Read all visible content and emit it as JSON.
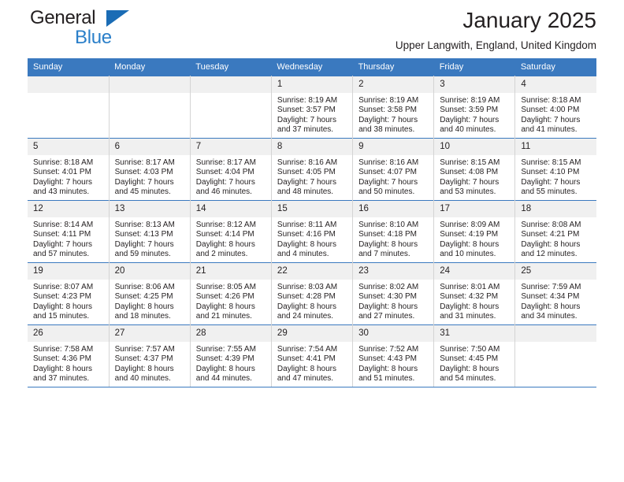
{
  "brand": {
    "word_one": "General",
    "word_two": "Blue",
    "triangle_color": "#1a6cb5",
    "blue_color": "#2a7fc9"
  },
  "header": {
    "title": "January 2025",
    "subtitle": "Upper Langwith, England, United Kingdom",
    "header_bg": "#3a79bf",
    "daynum_bg": "#f0f0f0"
  },
  "weekday_headers": [
    "Sunday",
    "Monday",
    "Tuesday",
    "Wednesday",
    "Thursday",
    "Friday",
    "Saturday"
  ],
  "labels": {
    "sunrise": "Sunrise:",
    "sunset": "Sunset:",
    "daylight": "Daylight:"
  },
  "weeks": [
    [
      {
        "day": "",
        "empty": true
      },
      {
        "day": "",
        "empty": true
      },
      {
        "day": "",
        "empty": true
      },
      {
        "day": "1",
        "sunrise": "Sunrise: 8:19 AM",
        "sunset": "Sunset: 3:57 PM",
        "daylight1": "Daylight: 7 hours",
        "daylight2": "and 37 minutes."
      },
      {
        "day": "2",
        "sunrise": "Sunrise: 8:19 AM",
        "sunset": "Sunset: 3:58 PM",
        "daylight1": "Daylight: 7 hours",
        "daylight2": "and 38 minutes."
      },
      {
        "day": "3",
        "sunrise": "Sunrise: 8:19 AM",
        "sunset": "Sunset: 3:59 PM",
        "daylight1": "Daylight: 7 hours",
        "daylight2": "and 40 minutes."
      },
      {
        "day": "4",
        "sunrise": "Sunrise: 8:18 AM",
        "sunset": "Sunset: 4:00 PM",
        "daylight1": "Daylight: 7 hours",
        "daylight2": "and 41 minutes."
      }
    ],
    [
      {
        "day": "5",
        "sunrise": "Sunrise: 8:18 AM",
        "sunset": "Sunset: 4:01 PM",
        "daylight1": "Daylight: 7 hours",
        "daylight2": "and 43 minutes."
      },
      {
        "day": "6",
        "sunrise": "Sunrise: 8:17 AM",
        "sunset": "Sunset: 4:03 PM",
        "daylight1": "Daylight: 7 hours",
        "daylight2": "and 45 minutes."
      },
      {
        "day": "7",
        "sunrise": "Sunrise: 8:17 AM",
        "sunset": "Sunset: 4:04 PM",
        "daylight1": "Daylight: 7 hours",
        "daylight2": "and 46 minutes."
      },
      {
        "day": "8",
        "sunrise": "Sunrise: 8:16 AM",
        "sunset": "Sunset: 4:05 PM",
        "daylight1": "Daylight: 7 hours",
        "daylight2": "and 48 minutes."
      },
      {
        "day": "9",
        "sunrise": "Sunrise: 8:16 AM",
        "sunset": "Sunset: 4:07 PM",
        "daylight1": "Daylight: 7 hours",
        "daylight2": "and 50 minutes."
      },
      {
        "day": "10",
        "sunrise": "Sunrise: 8:15 AM",
        "sunset": "Sunset: 4:08 PM",
        "daylight1": "Daylight: 7 hours",
        "daylight2": "and 53 minutes."
      },
      {
        "day": "11",
        "sunrise": "Sunrise: 8:15 AM",
        "sunset": "Sunset: 4:10 PM",
        "daylight1": "Daylight: 7 hours",
        "daylight2": "and 55 minutes."
      }
    ],
    [
      {
        "day": "12",
        "sunrise": "Sunrise: 8:14 AM",
        "sunset": "Sunset: 4:11 PM",
        "daylight1": "Daylight: 7 hours",
        "daylight2": "and 57 minutes."
      },
      {
        "day": "13",
        "sunrise": "Sunrise: 8:13 AM",
        "sunset": "Sunset: 4:13 PM",
        "daylight1": "Daylight: 7 hours",
        "daylight2": "and 59 minutes."
      },
      {
        "day": "14",
        "sunrise": "Sunrise: 8:12 AM",
        "sunset": "Sunset: 4:14 PM",
        "daylight1": "Daylight: 8 hours",
        "daylight2": "and 2 minutes."
      },
      {
        "day": "15",
        "sunrise": "Sunrise: 8:11 AM",
        "sunset": "Sunset: 4:16 PM",
        "daylight1": "Daylight: 8 hours",
        "daylight2": "and 4 minutes."
      },
      {
        "day": "16",
        "sunrise": "Sunrise: 8:10 AM",
        "sunset": "Sunset: 4:18 PM",
        "daylight1": "Daylight: 8 hours",
        "daylight2": "and 7 minutes."
      },
      {
        "day": "17",
        "sunrise": "Sunrise: 8:09 AM",
        "sunset": "Sunset: 4:19 PM",
        "daylight1": "Daylight: 8 hours",
        "daylight2": "and 10 minutes."
      },
      {
        "day": "18",
        "sunrise": "Sunrise: 8:08 AM",
        "sunset": "Sunset: 4:21 PM",
        "daylight1": "Daylight: 8 hours",
        "daylight2": "and 12 minutes."
      }
    ],
    [
      {
        "day": "19",
        "sunrise": "Sunrise: 8:07 AM",
        "sunset": "Sunset: 4:23 PM",
        "daylight1": "Daylight: 8 hours",
        "daylight2": "and 15 minutes."
      },
      {
        "day": "20",
        "sunrise": "Sunrise: 8:06 AM",
        "sunset": "Sunset: 4:25 PM",
        "daylight1": "Daylight: 8 hours",
        "daylight2": "and 18 minutes."
      },
      {
        "day": "21",
        "sunrise": "Sunrise: 8:05 AM",
        "sunset": "Sunset: 4:26 PM",
        "daylight1": "Daylight: 8 hours",
        "daylight2": "and 21 minutes."
      },
      {
        "day": "22",
        "sunrise": "Sunrise: 8:03 AM",
        "sunset": "Sunset: 4:28 PM",
        "daylight1": "Daylight: 8 hours",
        "daylight2": "and 24 minutes."
      },
      {
        "day": "23",
        "sunrise": "Sunrise: 8:02 AM",
        "sunset": "Sunset: 4:30 PM",
        "daylight1": "Daylight: 8 hours",
        "daylight2": "and 27 minutes."
      },
      {
        "day": "24",
        "sunrise": "Sunrise: 8:01 AM",
        "sunset": "Sunset: 4:32 PM",
        "daylight1": "Daylight: 8 hours",
        "daylight2": "and 31 minutes."
      },
      {
        "day": "25",
        "sunrise": "Sunrise: 7:59 AM",
        "sunset": "Sunset: 4:34 PM",
        "daylight1": "Daylight: 8 hours",
        "daylight2": "and 34 minutes."
      }
    ],
    [
      {
        "day": "26",
        "sunrise": "Sunrise: 7:58 AM",
        "sunset": "Sunset: 4:36 PM",
        "daylight1": "Daylight: 8 hours",
        "daylight2": "and 37 minutes."
      },
      {
        "day": "27",
        "sunrise": "Sunrise: 7:57 AM",
        "sunset": "Sunset: 4:37 PM",
        "daylight1": "Daylight: 8 hours",
        "daylight2": "and 40 minutes."
      },
      {
        "day": "28",
        "sunrise": "Sunrise: 7:55 AM",
        "sunset": "Sunset: 4:39 PM",
        "daylight1": "Daylight: 8 hours",
        "daylight2": "and 44 minutes."
      },
      {
        "day": "29",
        "sunrise": "Sunrise: 7:54 AM",
        "sunset": "Sunset: 4:41 PM",
        "daylight1": "Daylight: 8 hours",
        "daylight2": "and 47 minutes."
      },
      {
        "day": "30",
        "sunrise": "Sunrise: 7:52 AM",
        "sunset": "Sunset: 4:43 PM",
        "daylight1": "Daylight: 8 hours",
        "daylight2": "and 51 minutes."
      },
      {
        "day": "31",
        "sunrise": "Sunrise: 7:50 AM",
        "sunset": "Sunset: 4:45 PM",
        "daylight1": "Daylight: 8 hours",
        "daylight2": "and 54 minutes."
      },
      {
        "day": "",
        "empty": true
      }
    ]
  ]
}
